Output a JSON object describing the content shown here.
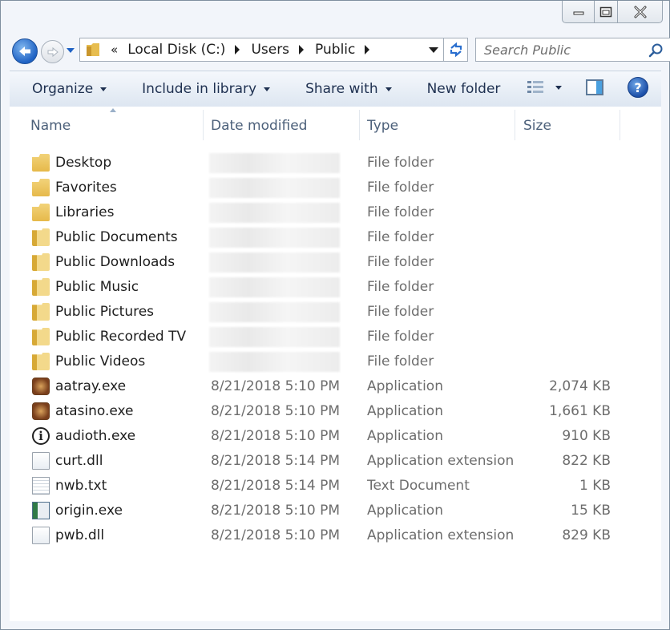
{
  "address": {
    "crumbs": [
      "Local Disk (C:)",
      "Users",
      "Public"
    ],
    "overflow_marker": "«"
  },
  "search": {
    "placeholder": "Search Public"
  },
  "toolbar": {
    "organize": "Organize",
    "include_in_library": "Include in library",
    "share_with": "Share with",
    "new_folder": "New folder",
    "help": "?"
  },
  "columns": {
    "name": "Name",
    "date_modified": "Date modified",
    "type": "Type",
    "size": "Size"
  },
  "files": [
    {
      "name": "Desktop",
      "date": "",
      "type": "File folder",
      "size": "",
      "icon": "folder-icon"
    },
    {
      "name": "Favorites",
      "date": "",
      "type": "File folder",
      "size": "",
      "icon": "folder-icon"
    },
    {
      "name": "Libraries",
      "date": "",
      "type": "File folder",
      "size": "",
      "icon": "folder-icon"
    },
    {
      "name": "Public Documents",
      "date": "",
      "type": "File folder",
      "size": "",
      "icon": "folder-open-icon"
    },
    {
      "name": "Public Downloads",
      "date": "",
      "type": "File folder",
      "size": "",
      "icon": "folder-open-icon"
    },
    {
      "name": "Public Music",
      "date": "",
      "type": "File folder",
      "size": "",
      "icon": "folder-open-icon"
    },
    {
      "name": "Public Pictures",
      "date": "",
      "type": "File folder",
      "size": "",
      "icon": "folder-open-icon"
    },
    {
      "name": "Public Recorded TV",
      "date": "",
      "type": "File folder",
      "size": "",
      "icon": "folder-open-icon"
    },
    {
      "name": "Public Videos",
      "date": "",
      "type": "File folder",
      "size": "",
      "icon": "folder-open-icon"
    },
    {
      "name": "aatray.exe",
      "date": "8/21/2018 5:10 PM",
      "type": "Application",
      "size": "2,074 KB",
      "icon": "app-icon"
    },
    {
      "name": "atasino.exe",
      "date": "8/21/2018 5:10 PM",
      "type": "Application",
      "size": "1,661 KB",
      "icon": "app-icon"
    },
    {
      "name": "audioth.exe",
      "date": "8/21/2018 5:10 PM",
      "type": "Application",
      "size": "910 KB",
      "icon": "info-icon"
    },
    {
      "name": "curt.dll",
      "date": "8/21/2018 5:14 PM",
      "type": "Application extension",
      "size": "822 KB",
      "icon": "dll-icon"
    },
    {
      "name": "nwb.txt",
      "date": "8/21/2018 5:14 PM",
      "type": "Text Document",
      "size": "1 KB",
      "icon": "text-file-icon"
    },
    {
      "name": "origin.exe",
      "date": "8/21/2018 5:10 PM",
      "type": "Application",
      "size": "15 KB",
      "icon": "window-app-icon"
    },
    {
      "name": "pwb.dll",
      "date": "8/21/2018 5:10 PM",
      "type": "Application extension",
      "size": "829 KB",
      "icon": "dll-icon"
    }
  ]
}
